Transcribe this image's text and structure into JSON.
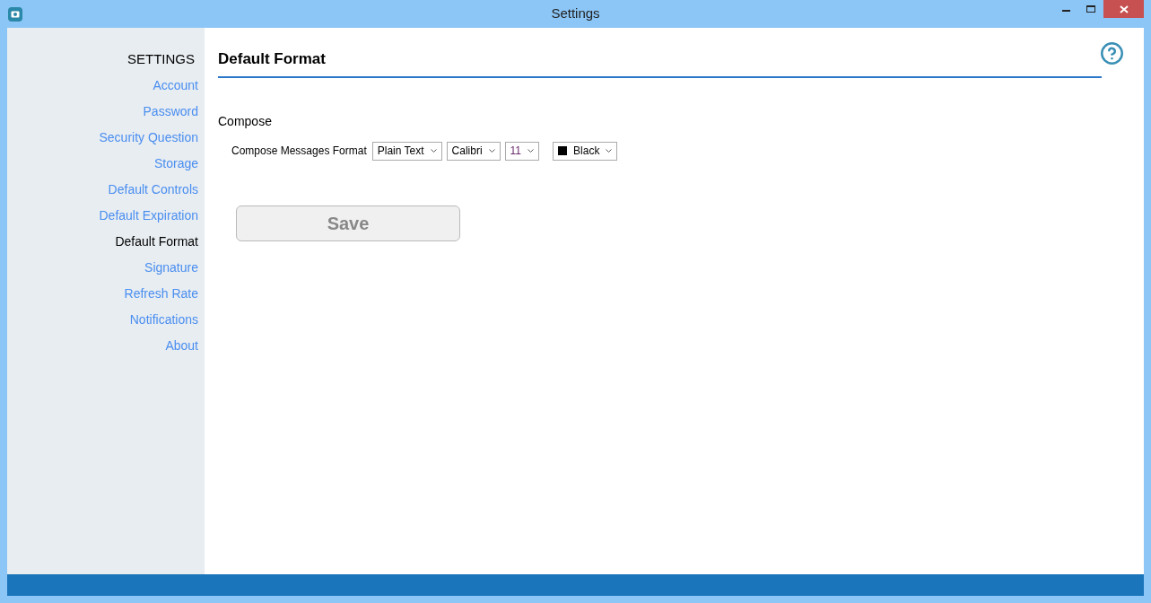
{
  "window": {
    "title": "Settings"
  },
  "sidebar": {
    "heading": "SETTINGS",
    "items": [
      {
        "label": "Account",
        "selected": false
      },
      {
        "label": "Password",
        "selected": false
      },
      {
        "label": "Security Question",
        "selected": false
      },
      {
        "label": "Storage",
        "selected": false
      },
      {
        "label": "Default Controls",
        "selected": false
      },
      {
        "label": "Default Expiration",
        "selected": false
      },
      {
        "label": "Default Format",
        "selected": true
      },
      {
        "label": "Signature",
        "selected": false
      },
      {
        "label": "Refresh Rate",
        "selected": false
      },
      {
        "label": "Notifications",
        "selected": false
      },
      {
        "label": "About",
        "selected": false
      }
    ]
  },
  "page": {
    "title": "Default Format",
    "section": "Compose",
    "row_label": "Compose Messages Format",
    "dropdowns": [
      {
        "kind": "text",
        "value": "Plain Text"
      },
      {
        "kind": "text",
        "value": "Calibri"
      },
      {
        "kind": "size",
        "value": "11"
      },
      {
        "kind": "color",
        "value": "Black"
      }
    ],
    "save_button": {
      "label": "Save",
      "disabled": true
    }
  }
}
